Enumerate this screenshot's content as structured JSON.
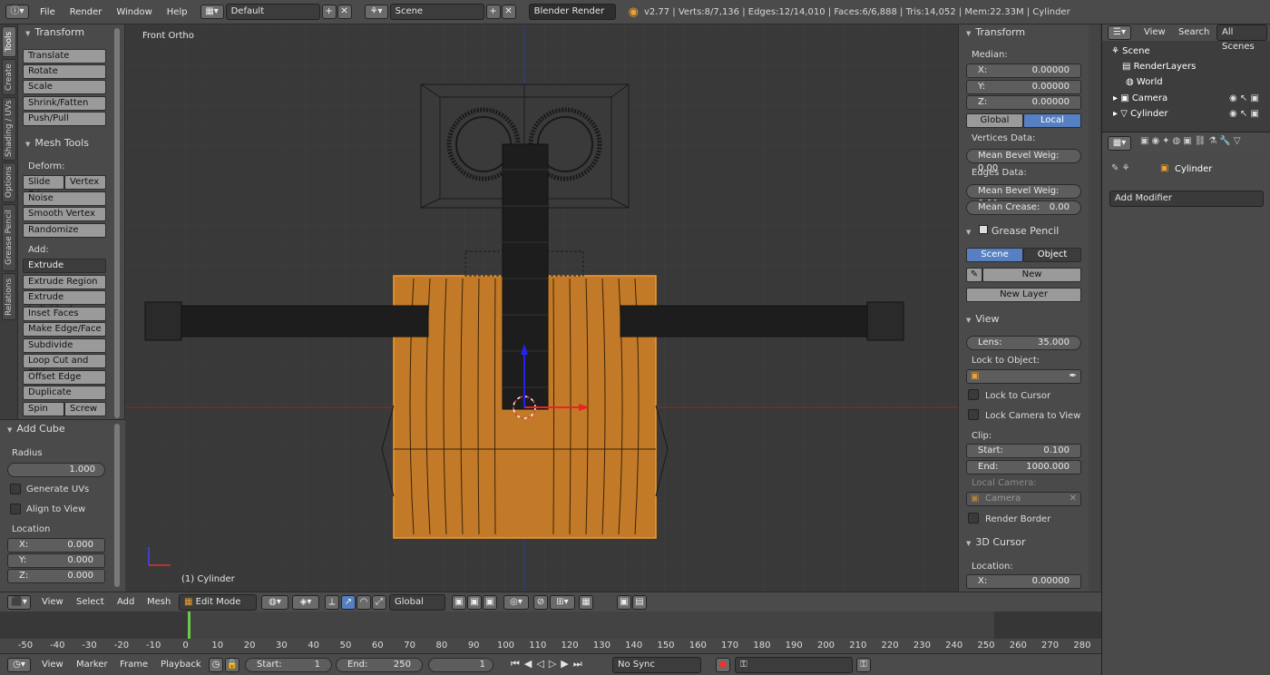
{
  "topbar": {
    "menus": [
      "File",
      "Render",
      "Window",
      "Help"
    ],
    "screen_layout": "Default",
    "scene": "Scene",
    "render_engine": "Blender Render",
    "stats": "v2.77 | Verts:8/7,136 | Edges:12/14,010 | Faces:6/6,888 | Tris:14,052 | Mem:22.33M | Cylinder"
  },
  "tabs": [
    "Tools",
    "Create",
    "Shading / UVs",
    "Options",
    "Grease Pencil",
    "Relations"
  ],
  "toolshelf": {
    "transform_title": "Transform",
    "transform_buttons": [
      "Translate",
      "Rotate",
      "Scale",
      "Shrink/Fatten",
      "Push/Pull"
    ],
    "mesh_tools_title": "Mesh Tools",
    "deform_label": "Deform:",
    "slide_edge": "Slide Ed",
    "vertex": "Vertex",
    "deform_buttons": [
      "Noise",
      "Smooth Vertex",
      "Randomize"
    ],
    "add_label": "Add:",
    "extrude": "Extrude",
    "add_buttons": [
      "Extrude Region",
      "Extrude Individual",
      "Inset Faces",
      "Make Edge/Face",
      "Subdivide",
      "Loop Cut and Slide",
      "Offset Edge Slide",
      "Duplicate"
    ],
    "spin": "Spin",
    "screw": "Screw"
  },
  "operator": {
    "title": "Add Cube",
    "radius_label": "Radius",
    "radius_value": "1.000",
    "generate_uvs": "Generate UVs",
    "align_to_view": "Align to View",
    "location_label": "Location",
    "x_label": "X:",
    "x_value": "0.000",
    "y_label": "Y:",
    "y_value": "0.000",
    "z_label": "Z:",
    "z_value": "0.000"
  },
  "viewport": {
    "view_name": "Front Ortho",
    "object_label": "(1) Cylinder"
  },
  "npanel": {
    "transform_title": "Transform",
    "median_label": "Median:",
    "x_label": "X:",
    "x_value": "0.00000",
    "y_label": "Y:",
    "y_value": "0.00000",
    "z_label": "Z:",
    "z_value": "0.00000",
    "global": "Global",
    "local": "Local",
    "vertices_data": "Vertices Data:",
    "mean_bevel_v": "Mean Bevel Weig: 0.00",
    "edges_data": "Edges Data:",
    "mean_bevel_e": "Mean Bevel Weig: 0.00",
    "mean_crease_label": "Mean Crease:",
    "mean_crease_value": "0.00",
    "grease_title": "Grease Pencil",
    "scene_btn": "Scene",
    "object_btn": "Object",
    "new_btn": "New",
    "new_layer": "New Layer",
    "view_title": "View",
    "lens_label": "Lens:",
    "lens_value": "35.000",
    "lock_object": "Lock to Object:",
    "lock_cursor": "Lock to Cursor",
    "lock_camera": "Lock Camera to View",
    "clip_label": "Clip:",
    "start_label": "Start:",
    "start_value": "0.100",
    "end_label": "End:",
    "end_value": "1000.000",
    "local_camera": "Local Camera:",
    "camera_field": "Camera",
    "render_border": "Render Border",
    "cursor_title": "3D Cursor",
    "location_label": "Location:",
    "cursor_x_label": "X:",
    "cursor_x_value": "0.00000"
  },
  "outliner": {
    "view": "View",
    "search": "Search",
    "all_scenes": "All Scenes",
    "items": [
      "Scene",
      "RenderLayers",
      "World",
      "Camera",
      "Cylinder"
    ]
  },
  "props": {
    "object_name": "Cylinder",
    "add_modifier": "Add Modifier"
  },
  "viewport_header": {
    "menus": [
      "View",
      "Select",
      "Add",
      "Mesh"
    ],
    "mode": "Edit Mode",
    "orientation": "Global"
  },
  "timeline": {
    "ticks": [
      "-50",
      "-40",
      "-30",
      "-20",
      "-10",
      "0",
      "10",
      "20",
      "30",
      "40",
      "50",
      "60",
      "70",
      "80",
      "90",
      "100",
      "110",
      "120",
      "130",
      "140",
      "150",
      "160",
      "170",
      "180",
      "190",
      "200",
      "210",
      "220",
      "230",
      "240",
      "250",
      "260",
      "270",
      "280"
    ]
  },
  "timeline_header": {
    "menus": [
      "View",
      "Marker",
      "Frame",
      "Playback"
    ],
    "start_label": "Start:",
    "start_value": "1",
    "end_label": "End:",
    "end_value": "250",
    "current": "1",
    "sync": "No Sync"
  }
}
